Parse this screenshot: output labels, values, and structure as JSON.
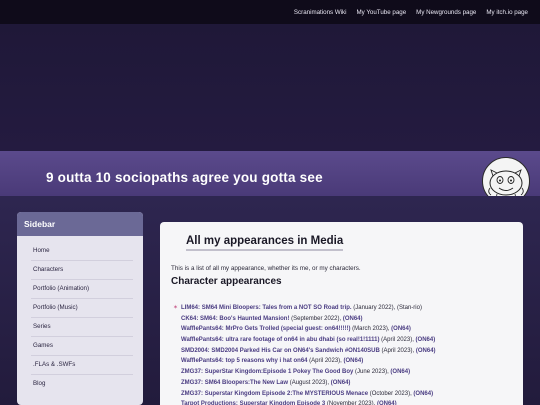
{
  "topnav": [
    "Scranimations Wiki",
    "My YouTube page",
    "My Newgrounds page",
    "My itch.io page"
  ],
  "banner": {
    "title": "9 outta 10 sociopaths agree you gotta see"
  },
  "sidebar": {
    "heading": "Sidebar",
    "items": [
      "Home",
      "Characters",
      "Portfolio (Animation)",
      "Portfolio (Music)",
      "Series",
      "Games",
      ".FLAs & .SWFs",
      "Blog"
    ]
  },
  "main": {
    "title": "All my appearances in Media",
    "intro": "This is a list of all my appearance, whether its me, or my characters.",
    "subtitle": "Character appearances",
    "entries": [
      {
        "who": "LIM64:",
        "title": "SM64 Mini Bloopers: Tales from a NOT SO Road trip.",
        "date": " (January 2022), ",
        "channel": "",
        "tail": "(Stan-rio)"
      },
      {
        "who": "CK64:",
        "title": "SM64: Boo's Haunted Mansion!",
        "date": " (September 2022), ",
        "channel": "(ON64)",
        "tail": ""
      },
      {
        "who": "WafflePants64:",
        "title": "MrPro Gets Trolled (special guest: on64!!!!!)",
        "date": " (March 2023), ",
        "channel": "(ON64)",
        "tail": ""
      },
      {
        "who": "WafflePants64:",
        "title": "ultra rare footage of on64 in abu dhabi (so real!1!1111)",
        "date": " (April 2023), ",
        "channel": "(ON64)",
        "tail": ""
      },
      {
        "who": "SMD2004:",
        "title": "SMD2004 Parked His Car on ON64's Sandwich #ON140SUB",
        "date": " (April 2023), ",
        "channel": "(ON64)",
        "tail": ""
      },
      {
        "who": "WafflePants64:",
        "title": "top 5 reasons why i hat on64",
        "date": " (April 2023), ",
        "channel": "(ON64)",
        "tail": ""
      },
      {
        "who": "ZMG37:",
        "title": "SuperStar Kingdom:Episode 1 Pokey The Good Boy",
        "date": " (June 2023), ",
        "channel": "(ON64)",
        "tail": ""
      },
      {
        "who": "ZMG37:",
        "title": "SM64 Bloopers:The New Law",
        "date": " (August 2023), ",
        "channel": "(ON64)",
        "tail": ""
      },
      {
        "who": "ZMG37:",
        "title": "Superstar Kingdom Episode 2:The MYSTERIOUS Menace",
        "date": " (October 2023), ",
        "channel": "(ON64)",
        "tail": ""
      },
      {
        "who": "Tarpot Productions:",
        "title": "Superstar Kingdom Episode 3",
        "date": " (November 2023), ",
        "channel": "(ON64)",
        "tail": ""
      }
    ]
  }
}
